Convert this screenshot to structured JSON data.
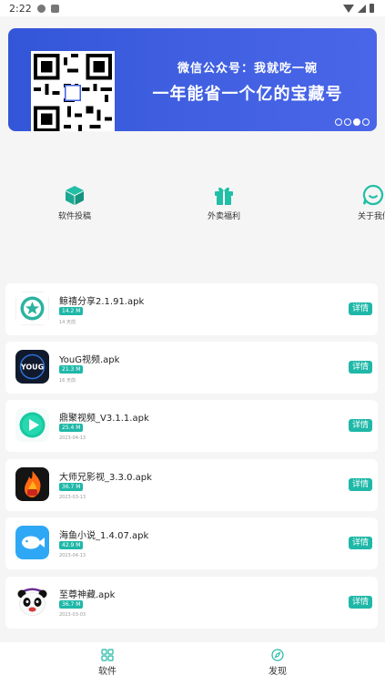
{
  "status_bar": {
    "time": "2:22"
  },
  "banner": {
    "line1": "微信公众号：我就吃一碗",
    "line2": "一年能省一个亿的宝藏号",
    "dots": 3,
    "active_dot": 2
  },
  "quick_menu": [
    {
      "label": "软件投稿",
      "icon": "cube-icon"
    },
    {
      "label": "外卖福利",
      "icon": "gift-icon"
    },
    {
      "label": "关于我们",
      "icon": "chat-bubble-icon"
    }
  ],
  "apps": [
    {
      "name": "鲸禧分享2.1.91.apk",
      "size": "14.2 M",
      "meta": "14 天前",
      "detail": "详情",
      "icon": "star-circle-app-icon"
    },
    {
      "name": "YouG视频.apk",
      "size": "21.3 M",
      "meta": "16 天前",
      "detail": "详情",
      "icon": "youg-app-icon",
      "icon_text": "YOUG"
    },
    {
      "name": "鼎聚视频_V3.1.1.apk",
      "size": "25.4 M",
      "meta": "2023-04-13",
      "detail": "详情",
      "icon": "play-app-icon"
    },
    {
      "name": "大师兄影视_3.3.0.apk",
      "size": "36.7 M",
      "meta": "2023-03-13",
      "detail": "详情",
      "icon": "flame-app-icon"
    },
    {
      "name": "海鱼小说_1.4.07.apk",
      "size": "42.9 M",
      "meta": "2023-04-13",
      "detail": "详情",
      "icon": "fish-app-icon"
    },
    {
      "name": "至尊神藏.apk",
      "size": "36.7 M",
      "meta": "2023-03-03",
      "detail": "详情",
      "icon": "panda-app-icon"
    }
  ],
  "bottom_nav": [
    {
      "label": "软件",
      "icon": "grid-icon"
    },
    {
      "label": "发现",
      "icon": "compass-icon"
    }
  ],
  "colors": {
    "accent": "#1fb8a8",
    "banner": "#3f5fe0"
  }
}
